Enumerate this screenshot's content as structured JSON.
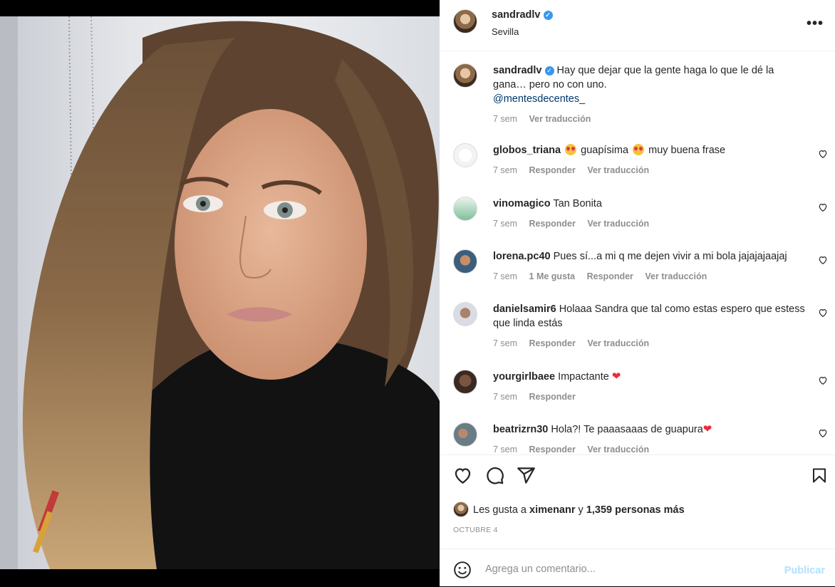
{
  "post": {
    "username": "sandradlv",
    "location": "Sevilla",
    "caption": "Hay que dejar que la gente haga lo que le dé la gana… pero no con uno.",
    "caption_mention": "@mentesdecentes_",
    "caption_time": "7 sem",
    "caption_translate": "Ver traducción"
  },
  "comments": [
    {
      "user": "globos_triana",
      "text_a": "guapísima",
      "text_b": "muy buena frase",
      "time": "7 sem",
      "reply": "Responder",
      "translate": "Ver traducción"
    },
    {
      "user": "vinomagico",
      "text": "Tan Bonita",
      "time": "7 sem",
      "reply": "Responder",
      "translate": "Ver traducción"
    },
    {
      "user": "lorena.pc40",
      "text": "Pues sí...a mi q me dejen vivir a mi bola jajajajaajaj",
      "time": "7 sem",
      "likes": "1 Me gusta",
      "reply": "Responder",
      "translate": "Ver traducción"
    },
    {
      "user": "danielsamir6",
      "text": "Holaaa Sandra que tal como estas espero que estess que linda estás",
      "time": "7 sem",
      "reply": "Responder",
      "translate": "Ver traducción"
    },
    {
      "user": "yourgirlbaee",
      "text": "Impactante",
      "time": "7 sem",
      "reply": "Responder"
    },
    {
      "user": "beatrizrn30",
      "text": "Hola?! Te paaasaaas de guapura",
      "time": "7 sem",
      "reply": "Responder",
      "translate": "Ver traducción"
    }
  ],
  "likes": {
    "prefix": "Les gusta a",
    "user": "ximenanr",
    "conj": "y",
    "count": "1,359 personas más"
  },
  "date": "OCTUBRE 4",
  "comment_box": {
    "placeholder": "Agrega un comentario...",
    "publish": "Publicar"
  },
  "colors": {
    "link": "#00376b",
    "muted": "#8e8e8e",
    "verified": "#3897f0",
    "publish_disabled": "#b2dffc"
  }
}
